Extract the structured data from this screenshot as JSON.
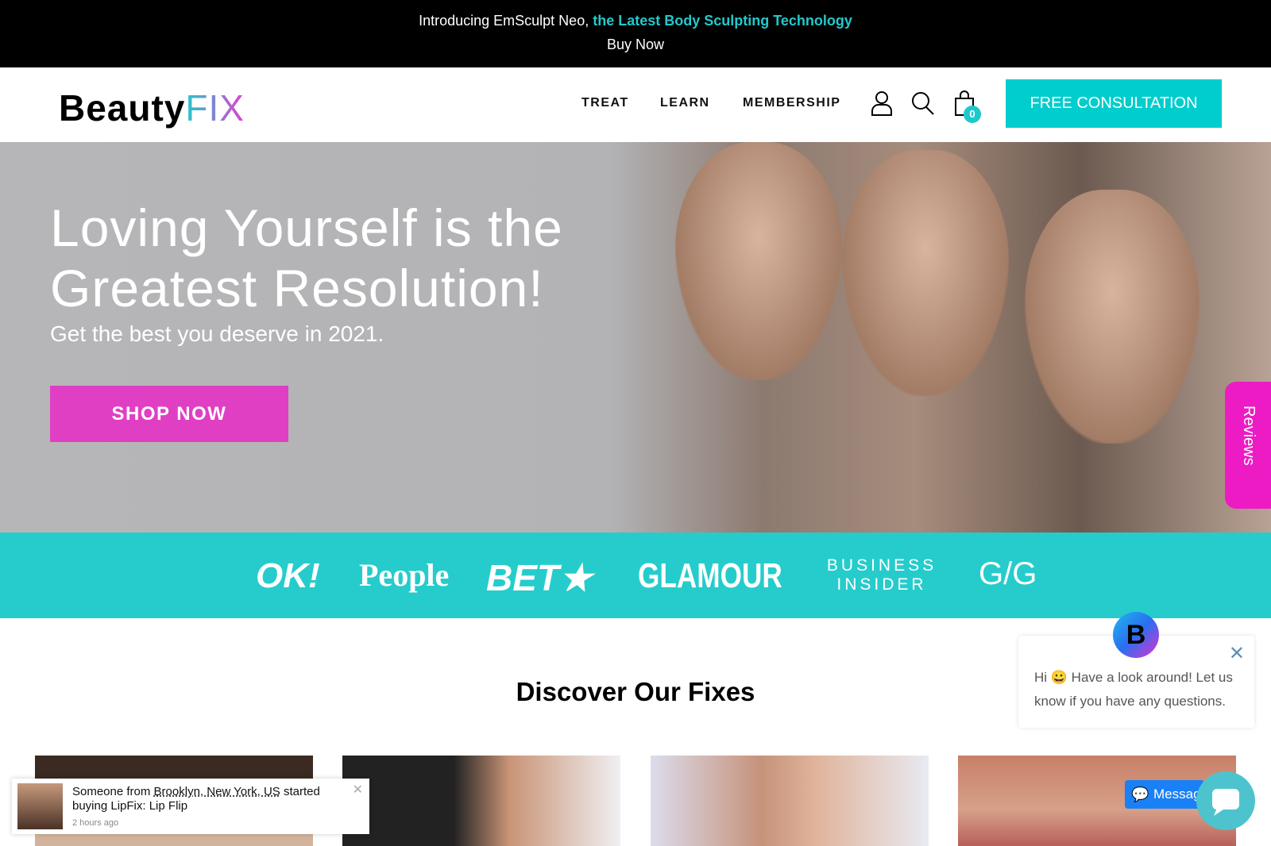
{
  "announcement": {
    "intro": "Introducing EmSculpt Neo, ",
    "highlight": "the Latest Body Sculpting Technology",
    "link": "Buy Now"
  },
  "nav": {
    "logo_main": "Beauty",
    "logo_accent": "FIX",
    "items": [
      "TREAT",
      "LEARN",
      "MEMBERSHIP"
    ],
    "cart_count": "0",
    "cta": "FREE CONSULTATION"
  },
  "hero": {
    "title_line1": "Loving Yourself is the",
    "title_line2": "Greatest Resolution!",
    "subtitle": "Get the best you deserve in 2021.",
    "button": "SHOP NOW"
  },
  "reviews_tab": "Reviews",
  "press": [
    "OK!",
    "People",
    "BET★",
    "GLAMOUR",
    "BUSINESS INSIDER",
    "G/G"
  ],
  "section_title": "Discover Our Fixes",
  "chat": {
    "avatar_letter": "B",
    "message": "Hi 😀 Have a look around! Let us know if you have any questions.",
    "messenger_label": "Messag"
  },
  "toast": {
    "prefix": "Someone from ",
    "location": "Brooklyn, New York, US",
    "suffix": " started buying LipFix: Lip Flip",
    "time": "2 hours ago"
  },
  "colors": {
    "accent": "#22c9cc",
    "pink": "#e03fc4"
  }
}
